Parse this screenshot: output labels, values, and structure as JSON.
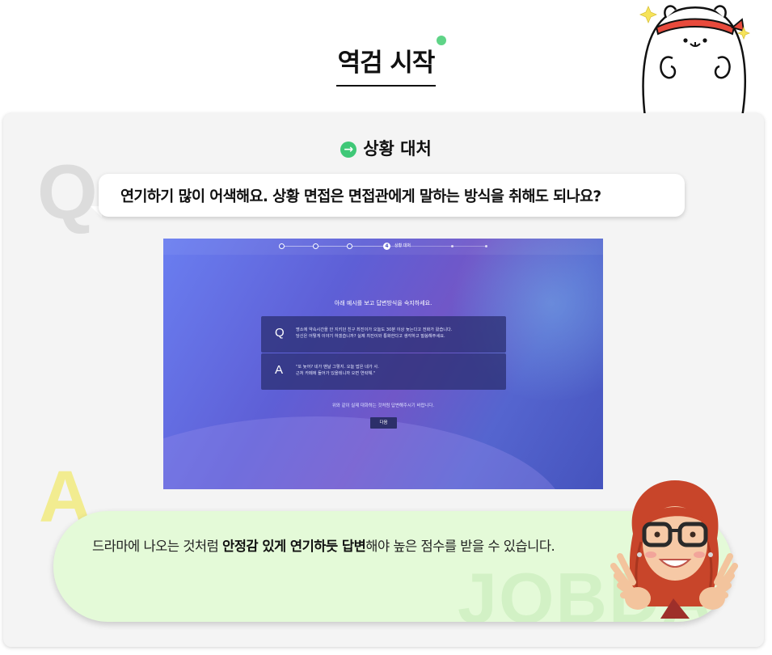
{
  "header": {
    "title": "역검 시작"
  },
  "section": {
    "icon": "arrow-right-circle-icon",
    "label": "상황 대처"
  },
  "question": {
    "marker": "Q",
    "text": "연기하기 많이 어색해요. 상황 면접은 면접관에게 말하는 방식을 취해도 되나요?"
  },
  "screenshot": {
    "active_step_number": "4",
    "active_step_label": "상황 대처",
    "instruction": "아래 예시를 보고 답변방식을 숙지하세요.",
    "example_q": {
      "marker": "Q",
      "line1": "명소에 약속시간을 안 지키던 친구 최진이가 오늘도 30분 이상 늦는다고 전화가 왔습니다.",
      "line2": "당신은 어떻게 이야기 하겠습니까? 실제 최진이와 통화한다고 생각하고 말씀해주세요."
    },
    "example_a": {
      "marker": "A",
      "line1": "\"또 늦어? 네가 맨날 그렇지. 오늘 밥은 네가 사.",
      "line2": "근처 카페에 들어가 있을테니까 오면 연락해.\""
    },
    "footnote": "위와 같이 실제 대화하는 것처럼 답변해주시기 바랍니다.",
    "next_button": "다음"
  },
  "answer": {
    "marker": "A",
    "text_before": "드라마에 나오는 것처럼 ",
    "text_bold": "안정감 있게 연기하듯 답변",
    "text_after": "해야 높은 점수를 받을 수 있습니다.",
    "watermark": "JOBDA"
  },
  "colors": {
    "accent_green": "#3fc877",
    "answer_bubble": "#e4fad8",
    "screenshot_gradient": "#5e5fd6"
  }
}
